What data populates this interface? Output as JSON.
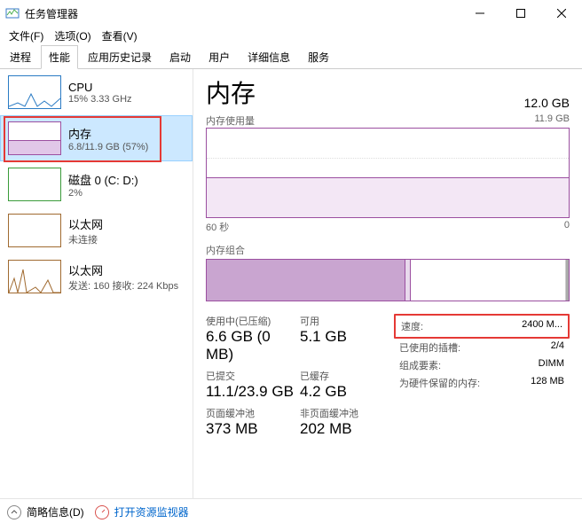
{
  "window": {
    "title": "任务管理器",
    "minimize": "—",
    "maximize": "□",
    "close": "✕"
  },
  "menu": {
    "file": "文件(F)",
    "options": "选项(O)",
    "view": "查看(V)"
  },
  "tabs": {
    "processes": "进程",
    "performance": "性能",
    "app_history": "应用历史记录",
    "startup": "启动",
    "users": "用户",
    "details": "详细信息",
    "services": "服务"
  },
  "sidebar": {
    "cpu": {
      "label": "CPU",
      "sub": "15% 3.33 GHz"
    },
    "memory": {
      "label": "内存",
      "sub": "6.8/11.9 GB (57%)"
    },
    "disk": {
      "label": "磁盘 0 (C: D:)",
      "sub": "2%"
    },
    "eth1": {
      "label": "以太网",
      "sub": "未连接"
    },
    "eth2": {
      "label": "以太网",
      "sub": "发送: 160 接收: 224 Kbps"
    }
  },
  "main": {
    "title": "内存",
    "capacity": "12.0 GB",
    "usage_label": "内存使用量",
    "usage_max": "11.9 GB",
    "time_label": "60 秒",
    "time_zero": "0",
    "composition_label": "内存组合"
  },
  "stats": {
    "in_use_label": "使用中(已压缩)",
    "in_use_value": "6.6 GB (0 MB)",
    "available_label": "可用",
    "available_value": "5.1 GB",
    "committed_label": "已提交",
    "committed_value": "11.1/23.9 GB",
    "cached_label": "已缓存",
    "cached_value": "4.2 GB",
    "paged_label": "页面缓冲池",
    "paged_value": "373 MB",
    "nonpaged_label": "非页面缓冲池",
    "nonpaged_value": "202 MB"
  },
  "specs": {
    "speed_label": "速度:",
    "speed_value": "2400 M...",
    "slots_label": "已使用的插槽:",
    "slots_value": "2/4",
    "form_label": "组成要素:",
    "form_value": "DIMM",
    "reserved_label": "为硬件保留的内存:",
    "reserved_value": "128 MB"
  },
  "footer": {
    "fewer_details": "简略信息(D)",
    "open_monitor": "打开资源监视器"
  }
}
